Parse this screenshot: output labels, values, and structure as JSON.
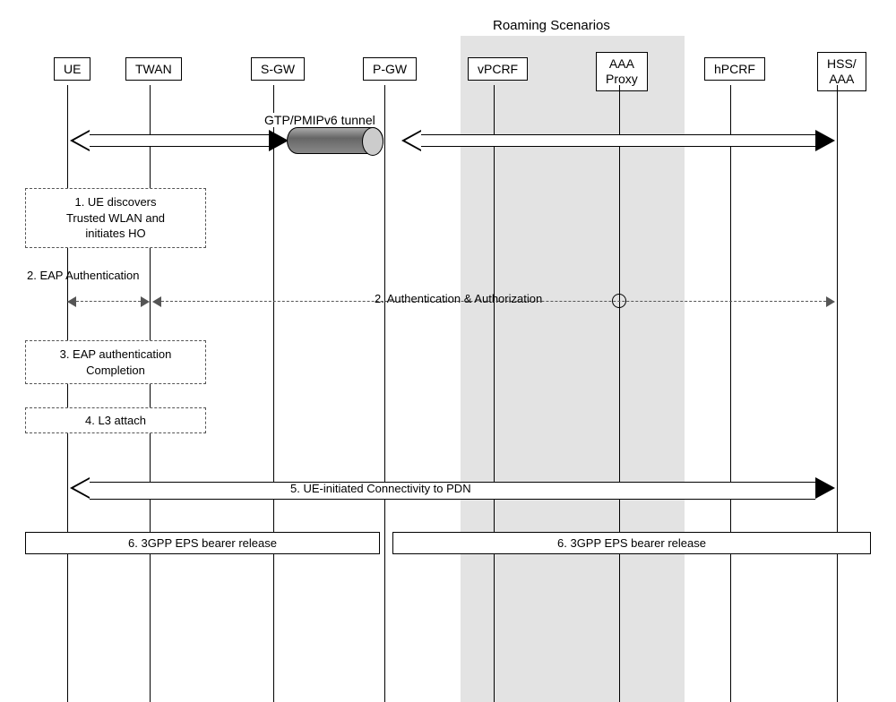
{
  "roaming_scenarios_label": "Roaming  Scenarios",
  "nodes": {
    "ue": "UE",
    "twan": "TWAN",
    "sgw": "S-GW",
    "pgw": "P-GW",
    "vpcrf": "vPCRF",
    "aaa_proxy_line1": "AAA",
    "aaa_proxy_line2": "Proxy",
    "hpcrf": "hPCRF",
    "hss_aaa_line1": "HSS/",
    "hss_aaa_line2": "AAA"
  },
  "tunnel_label": "GTP/PMIPv6 tunnel",
  "steps": {
    "step1_line1": "1. UE discovers",
    "step1_line2": "Trusted WLAN and",
    "step1_line3": "initiates HO",
    "step2_left": "2. EAP Authentication",
    "step2_right": "2. Authentication & Authorization",
    "step3_line1": "3. EAP authentication",
    "step3_line2": "Completion",
    "step4": "4. L3 attach",
    "step5": "5. UE-initiated Connectivity to PDN",
    "step6_left": "6. 3GPP EPS bearer release",
    "step6_right": "6. 3GPP EPS bearer release"
  },
  "chart_data": {
    "type": "sequence-diagram",
    "title": "Handover from 3GPP to Trusted WLAN (GTP/PMIPv6)",
    "participants": [
      "UE",
      "TWAN",
      "S-GW",
      "P-GW",
      "vPCRF",
      "AAA Proxy",
      "hPCRF",
      "HSS/AAA"
    ],
    "roaming_group": [
      "vPCRF",
      "AAA Proxy"
    ],
    "pre_existing": {
      "tunnel": {
        "between": [
          "S-GW",
          "P-GW"
        ],
        "label": "GTP/PMIPv6 tunnel"
      },
      "double_arrows": [
        {
          "between": [
            "UE",
            "S-GW"
          ],
          "style": "solid-open"
        },
        {
          "between": [
            "P-GW",
            "HSS/AAA"
          ],
          "style": "solid-open"
        }
      ]
    },
    "steps": [
      {
        "n": 1,
        "box_over": [
          "UE",
          "TWAN"
        ],
        "text": "UE discovers Trusted WLAN and initiates HO",
        "style": "dashed"
      },
      {
        "n": 2,
        "label_left": "EAP Authentication",
        "arrow": {
          "between": [
            "UE",
            "TWAN"
          ],
          "style": "dashed-double"
        }
      },
      {
        "n": 2,
        "arrow": {
          "between": [
            "TWAN",
            "HSS/AAA"
          ],
          "style": "dashed-double",
          "via_marker": "AAA Proxy"
        },
        "text": "Authentication & Authorization"
      },
      {
        "n": 3,
        "box_over": [
          "UE",
          "TWAN"
        ],
        "text": "EAP authentication Completion",
        "style": "dashed"
      },
      {
        "n": 4,
        "box_over": [
          "UE",
          "TWAN"
        ],
        "text": "L3 attach",
        "style": "dashed"
      },
      {
        "n": 5,
        "arrow": {
          "between": [
            "UE",
            "HSS/AAA"
          ],
          "style": "solid-open-double"
        },
        "text": "UE-initiated Connectivity to PDN"
      },
      {
        "n": 6,
        "box_over": [
          "UE",
          "S-GW+"
        ],
        "text": "3GPP EPS bearer release",
        "style": "solid"
      },
      {
        "n": 6,
        "box_over": [
          "P-GW",
          "HSS/AAA"
        ],
        "text": "3GPP EPS bearer release",
        "style": "solid"
      }
    ]
  }
}
